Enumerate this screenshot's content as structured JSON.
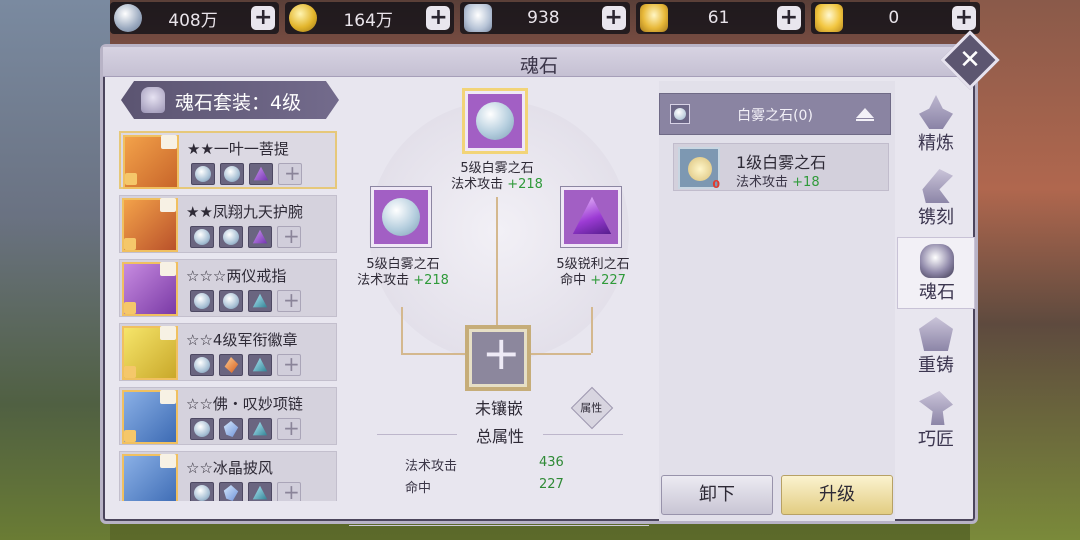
{
  "currencies": [
    {
      "icon": "silver-coin-icon",
      "value": "408万"
    },
    {
      "icon": "gold-coin-icon",
      "value": "164万"
    },
    {
      "icon": "silver-ingot-icon",
      "value": "938"
    },
    {
      "icon": "locked-gold-ingot-icon",
      "value": "61"
    },
    {
      "icon": "gold-ingot-icon",
      "value": "0"
    }
  ],
  "plus_label": "+",
  "panel": {
    "title": "魂石",
    "close_label": "✕"
  },
  "set_bar": {
    "label": "魂石套装：4级"
  },
  "equipment": [
    {
      "name": "★★一叶一菩提",
      "gems": [
        "pearl",
        "pearl",
        "tri",
        "empty"
      ],
      "selected": true
    },
    {
      "name": "★★凤翔九天护腕",
      "gems": [
        "pearl",
        "pearl",
        "tri",
        "empty"
      ]
    },
    {
      "name": "☆☆☆两仪戒指",
      "gems": [
        "pearl",
        "pearl",
        "teal",
        "empty"
      ]
    },
    {
      "name": "☆☆4级军衔徽章",
      "gems": [
        "pearl",
        "orange",
        "teal",
        "empty"
      ]
    },
    {
      "name": "☆☆佛・叹妙项链",
      "gems": [
        "pearl",
        "crystal",
        "teal",
        "empty"
      ]
    },
    {
      "name": "☆☆冰晶披风",
      "gems": [
        "pearl",
        "crystal",
        "teal",
        "empty"
      ]
    }
  ],
  "center": {
    "help": "?",
    "top_gem": {
      "name": "5级白雾之石",
      "stat": "法术攻击",
      "value": "+218"
    },
    "left_gem": {
      "name": "5级白雾之石",
      "stat": "法术攻击",
      "value": "+218"
    },
    "right_gem": {
      "name": "5级锐利之石",
      "stat": "命中",
      "value": "+227"
    },
    "empty_slot_label": "未镶嵌",
    "attr_button": "属性",
    "total_title": "总属性",
    "totals": [
      {
        "label": "法术攻击",
        "value": "436"
      },
      {
        "label": "命中",
        "value": "227"
      }
    ]
  },
  "right": {
    "header": "白雾之石(0)",
    "stone": {
      "name": "1级白雾之石",
      "stat": "法术攻击",
      "value": "+18",
      "count": "0"
    },
    "unload_button": "卸下",
    "upgrade_button": "升级"
  },
  "tabs": [
    {
      "label": "精炼"
    },
    {
      "label": "镌刻"
    },
    {
      "label": "魂石",
      "active": true
    },
    {
      "label": "重铸"
    },
    {
      "label": "巧匠"
    }
  ]
}
